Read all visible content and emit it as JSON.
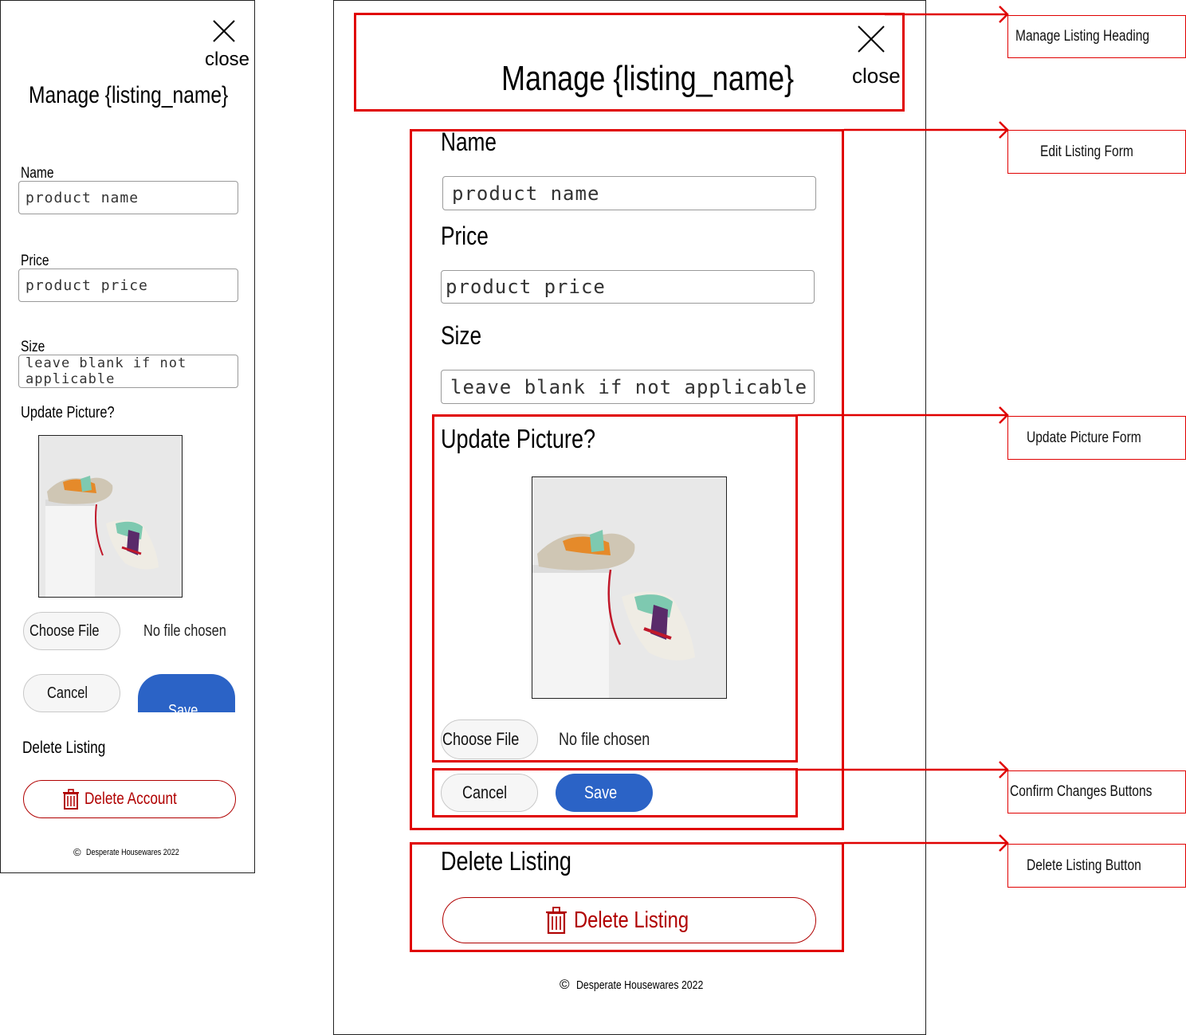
{
  "mobile": {
    "close_label": "close",
    "heading": "Manage {listing_name}",
    "name_label": "Name",
    "name_placeholder": "product name",
    "price_label": "Price",
    "price_placeholder": "product price",
    "size_label": "Size",
    "size_placeholder": "leave blank if not applicable",
    "update_picture_label": "Update Picture?",
    "choose_file_label": "Choose File",
    "no_file_label": "No file chosen",
    "cancel_label": "Cancel",
    "save_label": "Save",
    "delete_section_label": "Delete Listing",
    "delete_button_label": "Delete Account",
    "footer": "Desperate Housewares 2022"
  },
  "desktop": {
    "close_label": "close",
    "heading": "Manage {listing_name}",
    "name_label": "Name",
    "name_placeholder": "product name",
    "price_label": "Price",
    "price_placeholder": "product price",
    "size_label": "Size",
    "size_placeholder": "leave blank if not applicable",
    "update_picture_label": "Update Picture?",
    "choose_file_label": "Choose File",
    "no_file_label": "No file chosen",
    "cancel_label": "Cancel",
    "save_label": "Save",
    "delete_section_label": "Delete Listing",
    "delete_button_label": "Delete Listing",
    "footer": "Desperate Housewares 2022"
  },
  "annotations": [
    "Manage Listing Heading",
    "Edit Listing Form",
    "Update Picture Form",
    "Confirm Changes Buttons",
    "Delete Listing Button"
  ],
  "colors": {
    "annotation": "#e00000",
    "save": "#2b63c6",
    "danger": "#b00000"
  },
  "icons": [
    "close-icon",
    "trash-icon",
    "copyright-icon"
  ]
}
